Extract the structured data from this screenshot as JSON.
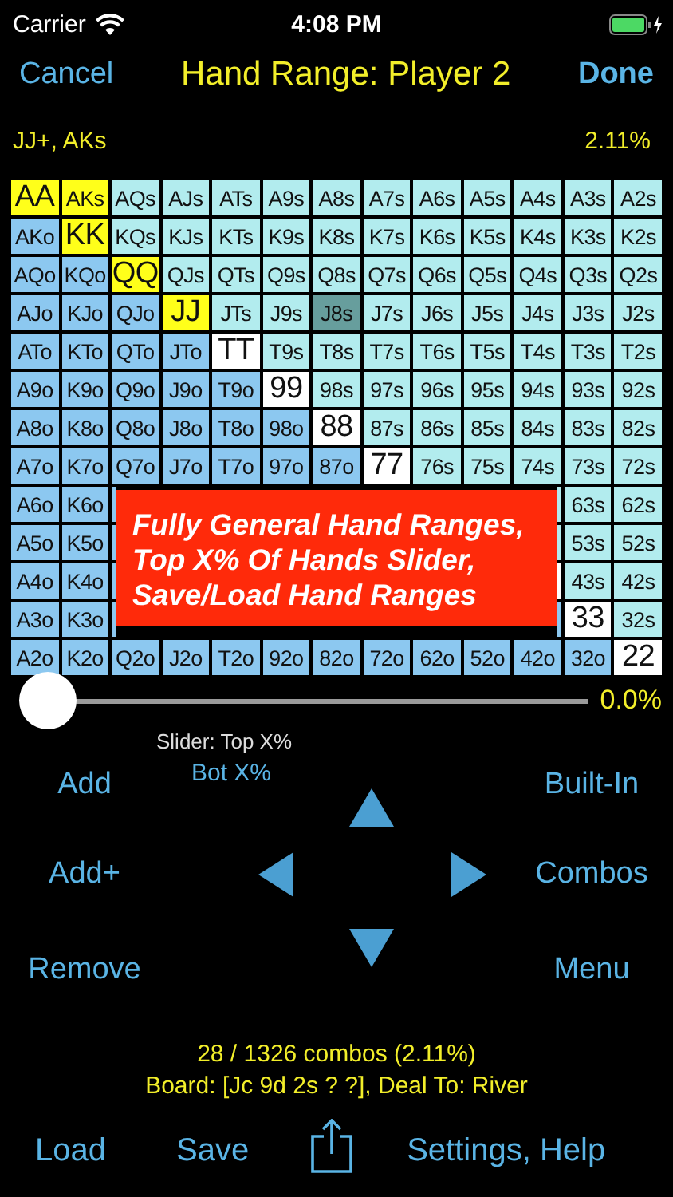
{
  "status_bar": {
    "carrier": "Carrier",
    "time": "4:08 PM"
  },
  "nav": {
    "cancel": "Cancel",
    "title": "Hand Range: Player 2",
    "done": "Done"
  },
  "range": {
    "text": "JJ+, AKs",
    "percent": "2.11%"
  },
  "grid": {
    "rows": [
      [
        {
          "text": "AA",
          "kind": "pair",
          "selected": true,
          "focused": false
        },
        {
          "text": "AKs",
          "kind": "suited",
          "selected": true,
          "focused": false
        },
        {
          "text": "AQs",
          "kind": "suited",
          "selected": false,
          "focused": false
        },
        {
          "text": "AJs",
          "kind": "suited",
          "selected": false,
          "focused": false
        },
        {
          "text": "ATs",
          "kind": "suited",
          "selected": false,
          "focused": false
        },
        {
          "text": "A9s",
          "kind": "suited",
          "selected": false,
          "focused": false
        },
        {
          "text": "A8s",
          "kind": "suited",
          "selected": false,
          "focused": false
        },
        {
          "text": "A7s",
          "kind": "suited",
          "selected": false,
          "focused": false
        },
        {
          "text": "A6s",
          "kind": "suited",
          "selected": false,
          "focused": false
        },
        {
          "text": "A5s",
          "kind": "suited",
          "selected": false,
          "focused": false
        },
        {
          "text": "A4s",
          "kind": "suited",
          "selected": false,
          "focused": false
        },
        {
          "text": "A3s",
          "kind": "suited",
          "selected": false,
          "focused": false
        },
        {
          "text": "A2s",
          "kind": "suited",
          "selected": false,
          "focused": false
        }
      ],
      [
        {
          "text": "AKo",
          "kind": "offsuit",
          "selected": false,
          "focused": false
        },
        {
          "text": "KK",
          "kind": "pair",
          "selected": true,
          "focused": false
        },
        {
          "text": "KQs",
          "kind": "suited",
          "selected": false,
          "focused": false
        },
        {
          "text": "KJs",
          "kind": "suited",
          "selected": false,
          "focused": false
        },
        {
          "text": "KTs",
          "kind": "suited",
          "selected": false,
          "focused": false
        },
        {
          "text": "K9s",
          "kind": "suited",
          "selected": false,
          "focused": false
        },
        {
          "text": "K8s",
          "kind": "suited",
          "selected": false,
          "focused": false
        },
        {
          "text": "K7s",
          "kind": "suited",
          "selected": false,
          "focused": false
        },
        {
          "text": "K6s",
          "kind": "suited",
          "selected": false,
          "focused": false
        },
        {
          "text": "K5s",
          "kind": "suited",
          "selected": false,
          "focused": false
        },
        {
          "text": "K4s",
          "kind": "suited",
          "selected": false,
          "focused": false
        },
        {
          "text": "K3s",
          "kind": "suited",
          "selected": false,
          "focused": false
        },
        {
          "text": "K2s",
          "kind": "suited",
          "selected": false,
          "focused": false
        }
      ],
      [
        {
          "text": "AQo",
          "kind": "offsuit",
          "selected": false,
          "focused": false
        },
        {
          "text": "KQo",
          "kind": "offsuit",
          "selected": false,
          "focused": false
        },
        {
          "text": "QQ",
          "kind": "pair",
          "selected": true,
          "focused": false
        },
        {
          "text": "QJs",
          "kind": "suited",
          "selected": false,
          "focused": false
        },
        {
          "text": "QTs",
          "kind": "suited",
          "selected": false,
          "focused": false
        },
        {
          "text": "Q9s",
          "kind": "suited",
          "selected": false,
          "focused": false
        },
        {
          "text": "Q8s",
          "kind": "suited",
          "selected": false,
          "focused": false
        },
        {
          "text": "Q7s",
          "kind": "suited",
          "selected": false,
          "focused": false
        },
        {
          "text": "Q6s",
          "kind": "suited",
          "selected": false,
          "focused": false
        },
        {
          "text": "Q5s",
          "kind": "suited",
          "selected": false,
          "focused": false
        },
        {
          "text": "Q4s",
          "kind": "suited",
          "selected": false,
          "focused": false
        },
        {
          "text": "Q3s",
          "kind": "suited",
          "selected": false,
          "focused": false
        },
        {
          "text": "Q2s",
          "kind": "suited",
          "selected": false,
          "focused": false
        }
      ],
      [
        {
          "text": "AJo",
          "kind": "offsuit",
          "selected": false,
          "focused": false
        },
        {
          "text": "KJo",
          "kind": "offsuit",
          "selected": false,
          "focused": false
        },
        {
          "text": "QJo",
          "kind": "offsuit",
          "selected": false,
          "focused": false
        },
        {
          "text": "JJ",
          "kind": "pair",
          "selected": true,
          "focused": false
        },
        {
          "text": "JTs",
          "kind": "suited",
          "selected": false,
          "focused": false
        },
        {
          "text": "J9s",
          "kind": "suited",
          "selected": false,
          "focused": false
        },
        {
          "text": "J8s",
          "kind": "suited",
          "selected": false,
          "focused": true
        },
        {
          "text": "J7s",
          "kind": "suited",
          "selected": false,
          "focused": false
        },
        {
          "text": "J6s",
          "kind": "suited",
          "selected": false,
          "focused": false
        },
        {
          "text": "J5s",
          "kind": "suited",
          "selected": false,
          "focused": false
        },
        {
          "text": "J4s",
          "kind": "suited",
          "selected": false,
          "focused": false
        },
        {
          "text": "J3s",
          "kind": "suited",
          "selected": false,
          "focused": false
        },
        {
          "text": "J2s",
          "kind": "suited",
          "selected": false,
          "focused": false
        }
      ],
      [
        {
          "text": "ATo",
          "kind": "offsuit",
          "selected": false,
          "focused": false
        },
        {
          "text": "KTo",
          "kind": "offsuit",
          "selected": false,
          "focused": false
        },
        {
          "text": "QTo",
          "kind": "offsuit",
          "selected": false,
          "focused": false
        },
        {
          "text": "JTo",
          "kind": "offsuit",
          "selected": false,
          "focused": false
        },
        {
          "text": "TT",
          "kind": "pair",
          "selected": false,
          "focused": false
        },
        {
          "text": "T9s",
          "kind": "suited",
          "selected": false,
          "focused": false
        },
        {
          "text": "T8s",
          "kind": "suited",
          "selected": false,
          "focused": false
        },
        {
          "text": "T7s",
          "kind": "suited",
          "selected": false,
          "focused": false
        },
        {
          "text": "T6s",
          "kind": "suited",
          "selected": false,
          "focused": false
        },
        {
          "text": "T5s",
          "kind": "suited",
          "selected": false,
          "focused": false
        },
        {
          "text": "T4s",
          "kind": "suited",
          "selected": false,
          "focused": false
        },
        {
          "text": "T3s",
          "kind": "suited",
          "selected": false,
          "focused": false
        },
        {
          "text": "T2s",
          "kind": "suited",
          "selected": false,
          "focused": false
        }
      ],
      [
        {
          "text": "A9o",
          "kind": "offsuit",
          "selected": false,
          "focused": false
        },
        {
          "text": "K9o",
          "kind": "offsuit",
          "selected": false,
          "focused": false
        },
        {
          "text": "Q9o",
          "kind": "offsuit",
          "selected": false,
          "focused": false
        },
        {
          "text": "J9o",
          "kind": "offsuit",
          "selected": false,
          "focused": false
        },
        {
          "text": "T9o",
          "kind": "offsuit",
          "selected": false,
          "focused": false
        },
        {
          "text": "99",
          "kind": "pair",
          "selected": false,
          "focused": false
        },
        {
          "text": "98s",
          "kind": "suited",
          "selected": false,
          "focused": false
        },
        {
          "text": "97s",
          "kind": "suited",
          "selected": false,
          "focused": false
        },
        {
          "text": "96s",
          "kind": "suited",
          "selected": false,
          "focused": false
        },
        {
          "text": "95s",
          "kind": "suited",
          "selected": false,
          "focused": false
        },
        {
          "text": "94s",
          "kind": "suited",
          "selected": false,
          "focused": false
        },
        {
          "text": "93s",
          "kind": "suited",
          "selected": false,
          "focused": false
        },
        {
          "text": "92s",
          "kind": "suited",
          "selected": false,
          "focused": false
        }
      ],
      [
        {
          "text": "A8o",
          "kind": "offsuit",
          "selected": false,
          "focused": false
        },
        {
          "text": "K8o",
          "kind": "offsuit",
          "selected": false,
          "focused": false
        },
        {
          "text": "Q8o",
          "kind": "offsuit",
          "selected": false,
          "focused": false
        },
        {
          "text": "J8o",
          "kind": "offsuit",
          "selected": false,
          "focused": false
        },
        {
          "text": "T8o",
          "kind": "offsuit",
          "selected": false,
          "focused": false
        },
        {
          "text": "98o",
          "kind": "offsuit",
          "selected": false,
          "focused": false
        },
        {
          "text": "88",
          "kind": "pair",
          "selected": false,
          "focused": false
        },
        {
          "text": "87s",
          "kind": "suited",
          "selected": false,
          "focused": false
        },
        {
          "text": "86s",
          "kind": "suited",
          "selected": false,
          "focused": false
        },
        {
          "text": "85s",
          "kind": "suited",
          "selected": false,
          "focused": false
        },
        {
          "text": "84s",
          "kind": "suited",
          "selected": false,
          "focused": false
        },
        {
          "text": "83s",
          "kind": "suited",
          "selected": false,
          "focused": false
        },
        {
          "text": "82s",
          "kind": "suited",
          "selected": false,
          "focused": false
        }
      ],
      [
        {
          "text": "A7o",
          "kind": "offsuit",
          "selected": false,
          "focused": false
        },
        {
          "text": "K7o",
          "kind": "offsuit",
          "selected": false,
          "focused": false
        },
        {
          "text": "Q7o",
          "kind": "offsuit",
          "selected": false,
          "focused": false
        },
        {
          "text": "J7o",
          "kind": "offsuit",
          "selected": false,
          "focused": false
        },
        {
          "text": "T7o",
          "kind": "offsuit",
          "selected": false,
          "focused": false
        },
        {
          "text": "97o",
          "kind": "offsuit",
          "selected": false,
          "focused": false
        },
        {
          "text": "87o",
          "kind": "offsuit",
          "selected": false,
          "focused": false
        },
        {
          "text": "77",
          "kind": "pair",
          "selected": false,
          "focused": false
        },
        {
          "text": "76s",
          "kind": "suited",
          "selected": false,
          "focused": false
        },
        {
          "text": "75s",
          "kind": "suited",
          "selected": false,
          "focused": false
        },
        {
          "text": "74s",
          "kind": "suited",
          "selected": false,
          "focused": false
        },
        {
          "text": "73s",
          "kind": "suited",
          "selected": false,
          "focused": false
        },
        {
          "text": "72s",
          "kind": "suited",
          "selected": false,
          "focused": false
        }
      ],
      [
        {
          "text": "A6o",
          "kind": "offsuit",
          "selected": false,
          "focused": false
        },
        {
          "text": "K6o",
          "kind": "offsuit",
          "selected": false,
          "focused": false
        },
        {
          "kind": "offsuit",
          "selected": false,
          "focused": false
        },
        {
          "kind": "hidden"
        },
        {
          "kind": "hidden"
        },
        {
          "kind": "hidden"
        },
        {
          "kind": "hidden"
        },
        {
          "kind": "hidden"
        },
        {
          "kind": "hidden"
        },
        {
          "kind": "hidden"
        },
        {
          "kind": "suited",
          "selected": false,
          "focused": false
        },
        {
          "text": "63s",
          "kind": "suited",
          "selected": false,
          "focused": false
        },
        {
          "text": "62s",
          "kind": "suited",
          "selected": false,
          "focused": false
        }
      ],
      [
        {
          "text": "A5o",
          "kind": "offsuit",
          "selected": false,
          "focused": false
        },
        {
          "text": "K5o",
          "kind": "offsuit",
          "selected": false,
          "focused": false
        },
        {
          "kind": "offsuit",
          "selected": false,
          "focused": false
        },
        {
          "kind": "hidden"
        },
        {
          "kind": "hidden"
        },
        {
          "kind": "hidden"
        },
        {
          "kind": "hidden"
        },
        {
          "kind": "hidden"
        },
        {
          "kind": "hidden"
        },
        {
          "kind": "hidden"
        },
        {
          "kind": "suited",
          "selected": false,
          "focused": false
        },
        {
          "text": "53s",
          "kind": "suited",
          "selected": false,
          "focused": false
        },
        {
          "text": "52s",
          "kind": "suited",
          "selected": false,
          "focused": false
        }
      ],
      [
        {
          "text": "A4o",
          "kind": "offsuit",
          "selected": false,
          "focused": false
        },
        {
          "text": "K4o",
          "kind": "offsuit",
          "selected": false,
          "focused": false
        },
        {
          "kind": "offsuit",
          "selected": false,
          "focused": false
        },
        {
          "kind": "hidden"
        },
        {
          "kind": "hidden"
        },
        {
          "kind": "hidden"
        },
        {
          "kind": "hidden"
        },
        {
          "kind": "hidden"
        },
        {
          "kind": "hidden"
        },
        {
          "kind": "hidden"
        },
        {
          "kind": "pair",
          "selected": false,
          "focused": false
        },
        {
          "text": "43s",
          "kind": "suited",
          "selected": false,
          "focused": false
        },
        {
          "text": "42s",
          "kind": "suited",
          "selected": false,
          "focused": false
        }
      ],
      [
        {
          "text": "A3o",
          "kind": "offsuit",
          "selected": false,
          "focused": false
        },
        {
          "text": "K3o",
          "kind": "offsuit",
          "selected": false,
          "focused": false
        },
        {
          "kind": "offsuit",
          "selected": false,
          "focused": false
        },
        {
          "kind": "hidden"
        },
        {
          "kind": "hidden"
        },
        {
          "kind": "hidden"
        },
        {
          "kind": "hidden"
        },
        {
          "kind": "hidden"
        },
        {
          "kind": "hidden"
        },
        {
          "kind": "hidden"
        },
        {
          "kind": "offsuit",
          "selected": false,
          "focused": false
        },
        {
          "text": "33",
          "kind": "pair",
          "selected": false,
          "focused": false
        },
        {
          "text": "32s",
          "kind": "suited",
          "selected": false,
          "focused": false
        }
      ],
      [
        {
          "text": "A2o",
          "kind": "offsuit",
          "selected": false,
          "focused": false
        },
        {
          "text": "K2o",
          "kind": "offsuit",
          "selected": false,
          "focused": false
        },
        {
          "text": "Q2o",
          "kind": "offsuit",
          "selected": false,
          "focused": false
        },
        {
          "text": "J2o",
          "kind": "offsuit",
          "selected": false,
          "focused": false
        },
        {
          "text": "T2o",
          "kind": "offsuit",
          "selected": false,
          "focused": false
        },
        {
          "text": "92o",
          "kind": "offsuit",
          "selected": false,
          "focused": false
        },
        {
          "text": "82o",
          "kind": "offsuit",
          "selected": false,
          "focused": false
        },
        {
          "text": "72o",
          "kind": "offsuit",
          "selected": false,
          "focused": false
        },
        {
          "text": "62o",
          "kind": "offsuit",
          "selected": false,
          "focused": false
        },
        {
          "text": "52o",
          "kind": "offsuit",
          "selected": false,
          "focused": false
        },
        {
          "text": "42o",
          "kind": "offsuit",
          "selected": false,
          "focused": false
        },
        {
          "text": "32o",
          "kind": "offsuit",
          "selected": false,
          "focused": false
        },
        {
          "text": "22",
          "kind": "pair",
          "selected": false,
          "focused": false
        }
      ]
    ]
  },
  "banner": {
    "lines": [
      "Fully General Hand Ranges,",
      "Top X% Of Hands Slider,",
      "Save/Load Hand Ranges"
    ]
  },
  "slider": {
    "level": 0,
    "reading": "0.0%",
    "mode_label": "Slider: Top X%",
    "alt_mode": "Bot X%"
  },
  "controls": {
    "add": "Add",
    "add_plus": "Add+",
    "remove": "Remove",
    "built_in": "Built-In",
    "combos": "Combos",
    "menu": "Menu"
  },
  "info": {
    "combos": "28 / 1326 combos (2.11%)",
    "board": "Board: [Jc 9d 2s ? ?], Deal To: River"
  },
  "toolbar": {
    "load": "Load",
    "save": "Save",
    "settings": "Settings, Help"
  }
}
